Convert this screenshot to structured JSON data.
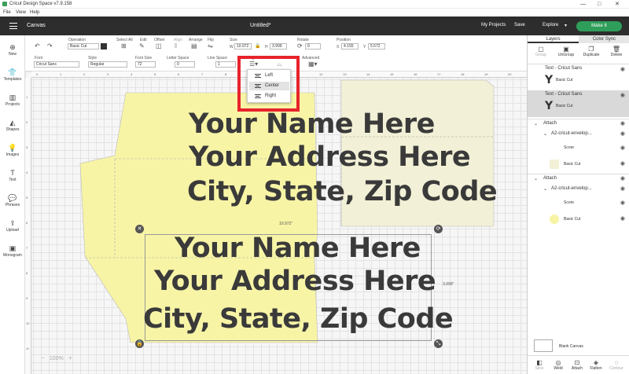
{
  "window": {
    "title": "Cricut Design Space  v7.9.158",
    "controls": [
      "—",
      "□",
      "✕"
    ]
  },
  "menu": [
    "File",
    "View",
    "Help"
  ],
  "header": {
    "section": "Canvas",
    "doc_title": "Untitled*",
    "my_projects": "My Projects",
    "save": "Save",
    "machine": "Explore",
    "make_it": "Make It"
  },
  "toolbar": {
    "undo_icon": "undo-icon",
    "redo_icon": "redo-icon",
    "operation_label": "Operation",
    "operation_value": "Basic Cut",
    "select_all_label": "Select All",
    "edit_label": "Edit",
    "offset_label": "Offset",
    "align_label": "Align",
    "arrange_label": "Arrange",
    "flip_label": "Flip",
    "size_label": "Size",
    "size_w_label": "W",
    "size_w": "10.972",
    "size_h_label": "H",
    "size_h": "3.999",
    "rotate_label": "Rotate",
    "rotate_value": "0",
    "position_label": "Position",
    "pos_x_label": "X",
    "pos_x": "4.155",
    "pos_y_label": "Y",
    "pos_y": "5.572",
    "font_label": "Font",
    "font_value": "Cricut Sans",
    "style_label": "Style",
    "style_value": "Regular",
    "font_size_label": "Font Size",
    "font_size_value": "72",
    "letter_space_label": "Letter Space",
    "letter_space_value": "0",
    "line_space_label": "Line Space",
    "line_space_value": "1",
    "alignment_label": "Alignment",
    "curve_label": "Curve",
    "advanced_label": "Advanced"
  },
  "alignment_menu": {
    "items": [
      "Left",
      "Center",
      "Right"
    ],
    "selected": "Center"
  },
  "sidebar": [
    {
      "label": "New",
      "icon": "plus-icon"
    },
    {
      "label": "Templates",
      "icon": "shirt-icon"
    },
    {
      "label": "Projects",
      "icon": "folder-icon"
    },
    {
      "label": "Shapes",
      "icon": "shapes-icon"
    },
    {
      "label": "Images",
      "icon": "lightbulb-icon"
    },
    {
      "label": "Text",
      "icon": "text-icon"
    },
    {
      "label": "Phrases",
      "icon": "speech-bubble-icon"
    },
    {
      "label": "Upload",
      "icon": "upload-icon"
    },
    {
      "label": "Monogram",
      "icon": "monogram-icon"
    }
  ],
  "canvas": {
    "ruler_top": [
      "0",
      "1",
      "2",
      "3",
      "4",
      "5",
      "6",
      "7",
      "8",
      "9",
      "10",
      "11",
      "12",
      "13",
      "14",
      "15",
      "16",
      "17",
      "18",
      "19",
      "20"
    ],
    "ruler_left": [
      "1",
      "2",
      "3",
      "4",
      "5",
      "6",
      "7",
      "8",
      "9",
      "10",
      "11"
    ],
    "text_top": [
      "Your Name Here",
      "Your Address Here",
      "City, State, Zip Code"
    ],
    "text_selected": [
      "Your Name Here",
      "Your Address Here",
      "City, State, Zip Code"
    ],
    "width_label": "10.972\"",
    "height_label": "3.999\"",
    "zoom": "100%",
    "zoom_minus": "−",
    "zoom_plus": "+"
  },
  "layers_panel": {
    "tabs": [
      "Layers",
      "Color Sync"
    ],
    "actions": [
      {
        "label": "Group",
        "icon": "group-icon"
      },
      {
        "label": "UnGroup",
        "icon": "ungroup-icon"
      },
      {
        "label": "Duplicate",
        "icon": "duplicate-icon"
      },
      {
        "label": "Delete",
        "icon": "trash-icon"
      }
    ],
    "rows": [
      {
        "title": "Text - Cricut Sans",
        "sub": "Basic Cut",
        "thumb": "Y"
      },
      {
        "title": "Text - Cricut Sans",
        "sub": "Basic Cut",
        "thumb": "Y"
      },
      {
        "title": "Attach"
      },
      {
        "title": "A2-cricut-envelop...",
        "children": [
          "Score",
          "Basic Cut"
        ]
      },
      {
        "title": "Attach"
      },
      {
        "title": "A2-cricut-envelop...",
        "children": [
          "Score",
          "Basic Cut"
        ]
      }
    ],
    "blank_canvas": "Blank Canvas",
    "bottom_actions": [
      "Slice",
      "Weld",
      "Attach",
      "Flatten",
      "Contour"
    ]
  },
  "colors": {
    "header_bg": "#2d2d2d",
    "make_it": "#2f9e5b",
    "envelope_yellow": "#f7f4a6",
    "envelope_cream": "#f2f0d6",
    "highlight": "#e8232b"
  }
}
